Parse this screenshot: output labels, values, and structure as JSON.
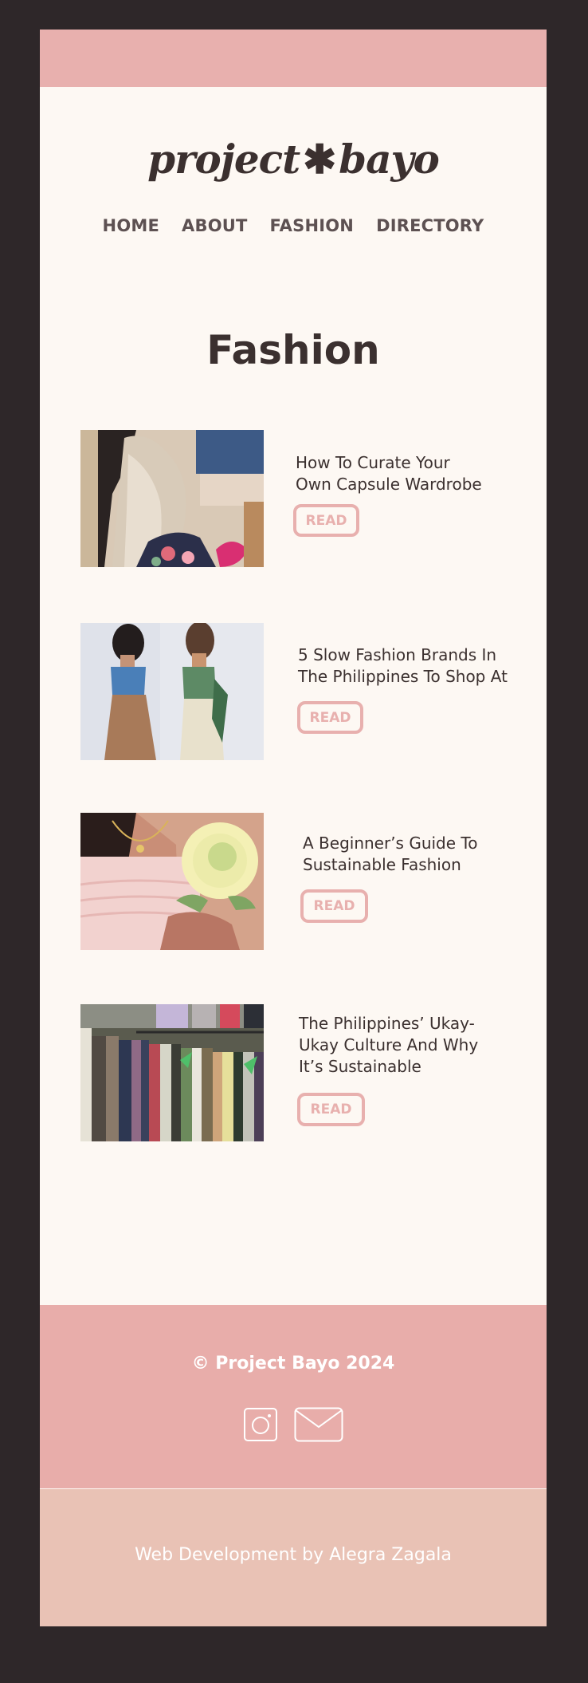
{
  "site": {
    "logo_text": "project",
    "logo_star": "✱",
    "logo_text2": "bayo"
  },
  "nav": {
    "items": [
      "HOME",
      "ABOUT",
      "FASHION",
      "DIRECTORY"
    ]
  },
  "main": {
    "title": "Fashion",
    "articles": [
      {
        "title_line1": "How To Curate Your",
        "title_line2": "Own Capsule Wardrobe",
        "title_line3": "",
        "button": "READ"
      },
      {
        "title_line1": "5 Slow Fashion Brands In",
        "title_line2": "The Philippines To Shop At",
        "title_line3": "",
        "button": "READ"
      },
      {
        "title_line1": "A Beginner’s Guide To",
        "title_line2": "Sustainable Fashion",
        "title_line3": "",
        "button": "READ"
      },
      {
        "title_line1": "The Philippines’ Ukay-",
        "title_line2": "Ukay Culture And Why",
        "title_line3": "It’s Sustainable",
        "button": "READ"
      }
    ]
  },
  "footer": {
    "copyright": "© Project Bayo 2024",
    "icons": [
      "instagram-icon",
      "mail-icon"
    ],
    "credit": "Web Development by Alegra Zagala"
  },
  "colors": {
    "accent_pink": "#e8b0ae",
    "background": "#fdf8f3",
    "frame": "#2e2729",
    "text_dark": "#3b302f",
    "credit_bar": "#e9c2b5"
  }
}
